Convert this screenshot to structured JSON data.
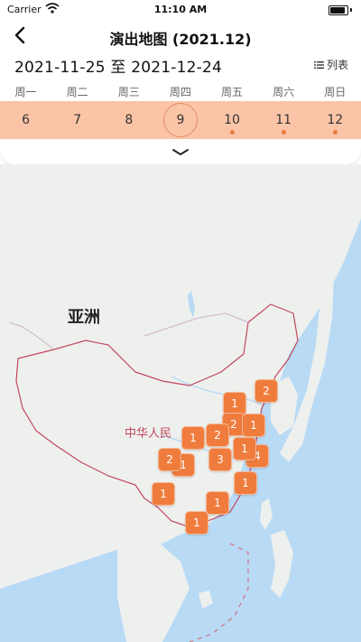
{
  "status_bar": {
    "carrier": "Carrier",
    "time": "11:10 AM"
  },
  "nav": {
    "title": "演出地图 (2021.12)"
  },
  "range": {
    "text": "2021-11-25 至 2021-12-24",
    "list_label": "列表"
  },
  "weekdays": [
    "周一",
    "周二",
    "周三",
    "周四",
    "周五",
    "周六",
    "周日"
  ],
  "days": [
    {
      "num": "6",
      "selected": false,
      "has_event": false
    },
    {
      "num": "7",
      "selected": false,
      "has_event": false
    },
    {
      "num": "8",
      "selected": false,
      "has_event": false
    },
    {
      "num": "9",
      "selected": true,
      "has_event": false
    },
    {
      "num": "10",
      "selected": false,
      "has_event": true
    },
    {
      "num": "11",
      "selected": false,
      "has_event": true
    },
    {
      "num": "12",
      "selected": false,
      "has_event": true
    }
  ],
  "map": {
    "labels": {
      "asia": "亚洲",
      "china": "中华人民"
    },
    "markers": [
      {
        "count": "2"
      },
      {
        "count": "1"
      },
      {
        "count": "2"
      },
      {
        "count": "1"
      },
      {
        "count": "2"
      },
      {
        "count": "1"
      },
      {
        "count": "3"
      },
      {
        "count": "4"
      },
      {
        "count": "1"
      },
      {
        "count": "1"
      },
      {
        "count": "2"
      },
      {
        "count": "1"
      },
      {
        "count": "1"
      },
      {
        "count": "1"
      },
      {
        "count": "1"
      }
    ]
  },
  "colors": {
    "marker": "#ef7c3d",
    "strip": "#fbc4a6",
    "sea": "#b8daf5",
    "land": "#eef0ee",
    "border": "#c2475e"
  }
}
